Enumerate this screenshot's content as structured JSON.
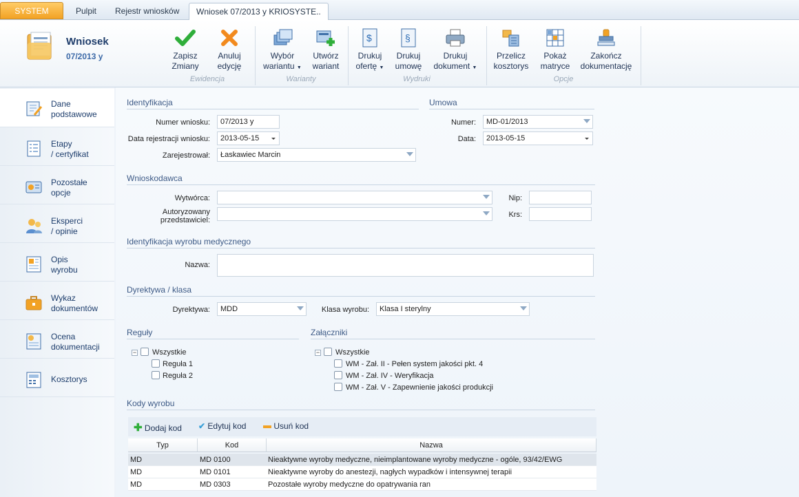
{
  "tabs": {
    "system": "SYSTEM",
    "pulpit": "Pulpit",
    "rejestr": "Rejestr wniosków",
    "active": "Wniosek 07/2013 y  KRIOSYSTE.."
  },
  "header": {
    "title": "Wniosek",
    "subtitle": "07/2013 y"
  },
  "ribbon": {
    "zapisz": [
      "Zapisz",
      "Zmiany"
    ],
    "anuluj": [
      "Anuluj",
      "edycję"
    ],
    "wybor": [
      "Wybór",
      "wariantu"
    ],
    "utworz": [
      "Utwórz",
      "wariant"
    ],
    "drukuj_oferte": [
      "Drukuj",
      "ofertę"
    ],
    "drukuj_umowe": [
      "Drukuj",
      "umowę"
    ],
    "drukuj_dokument": [
      "Drukuj",
      "dokument"
    ],
    "przelicz": [
      "Przelicz",
      "kosztorys"
    ],
    "pokaz": [
      "Pokaż",
      "matryce"
    ],
    "zakoncz": [
      "Zakończ",
      "dokumentację"
    ],
    "groups": {
      "ewidencja": "Ewidencja",
      "warianty": "Warianty",
      "wydruki": "Wydruki",
      "opcje": "Opcje"
    }
  },
  "nav": [
    [
      "Dane",
      "podstawowe"
    ],
    [
      "Etapy",
      "/ certyfikat"
    ],
    [
      "Pozostałe",
      "opcje"
    ],
    [
      "Eksperci",
      "/ opinie"
    ],
    [
      "Opis",
      "wyrobu"
    ],
    [
      "Wykaz",
      "dokumentów"
    ],
    [
      "Ocena",
      "dokumentacji"
    ],
    [
      "Kosztorys"
    ]
  ],
  "identyfikacja": {
    "section": "Identyfikacja",
    "numer_label": "Numer wniosku:",
    "numer_value": "07/2013 y",
    "data_label": "Data rejestracji wniosku:",
    "data_value": "2013-05-15",
    "zarej_label": "Zarejestrował:",
    "zarej_value": "Łaskawiec Marcin"
  },
  "umowa": {
    "section": "Umowa",
    "numer_label": "Numer:",
    "numer_value": "MD-01/2013",
    "data_label": "Data:",
    "data_value": "2013-05-15"
  },
  "wnioskodawca": {
    "section": "Wnioskodawca",
    "wytworca_label": "Wytwórca:",
    "wytworca_value": "",
    "autoryzowany_label": [
      "Autoryzowany",
      "przedstawiciel:"
    ],
    "autoryzowany_value": "",
    "nip_label": "Nip:",
    "nip_value": "",
    "krs_label": "Krs:",
    "krs_value": ""
  },
  "wyrob": {
    "section": "Identyfikacja wyrobu medycznego",
    "nazwa_label": "Nazwa:",
    "nazwa_value": ""
  },
  "dyrektywa": {
    "section": "Dyrektywa / klasa",
    "dyrektywa_label": "Dyrektywa:",
    "dyrektywa_value": "MDD",
    "klasa_label": "Klasa wyrobu:",
    "klasa_value": "Klasa I sterylny"
  },
  "reguly": {
    "section": "Reguły",
    "all": "Wszystkie",
    "items": [
      "Reguła 1",
      "Reguła 2"
    ]
  },
  "zalaczniki": {
    "section": "Załączniki",
    "all": "Wszystkie",
    "items": [
      "WM - Zał. II - Pełen system jakości pkt. 4",
      "WM - Zał. IV - Weryfikacja",
      "WM - Zał. V - Zapewnienie jakości produkcji"
    ]
  },
  "kody": {
    "section": "Kody wyrobu",
    "dodaj": "Dodaj kod",
    "edytuj": "Edytuj kod",
    "usun": "Usuń kod",
    "columns": [
      "Typ",
      "Kod",
      "Nazwa"
    ],
    "rows": [
      [
        "MD",
        "MD 0100",
        "Nieaktywne wyroby medyczne, nieimplantowane wyroby medyczne - ogóle, 93/42/EWG"
      ],
      [
        "MD",
        "MD 0101",
        "Nieaktywne wyroby do anestezji, nagłych wypadków i intensywnej terapii"
      ],
      [
        "MD",
        "MD 0303",
        "Pozostałe wyroby medyczne do opatrywania ran"
      ]
    ]
  }
}
